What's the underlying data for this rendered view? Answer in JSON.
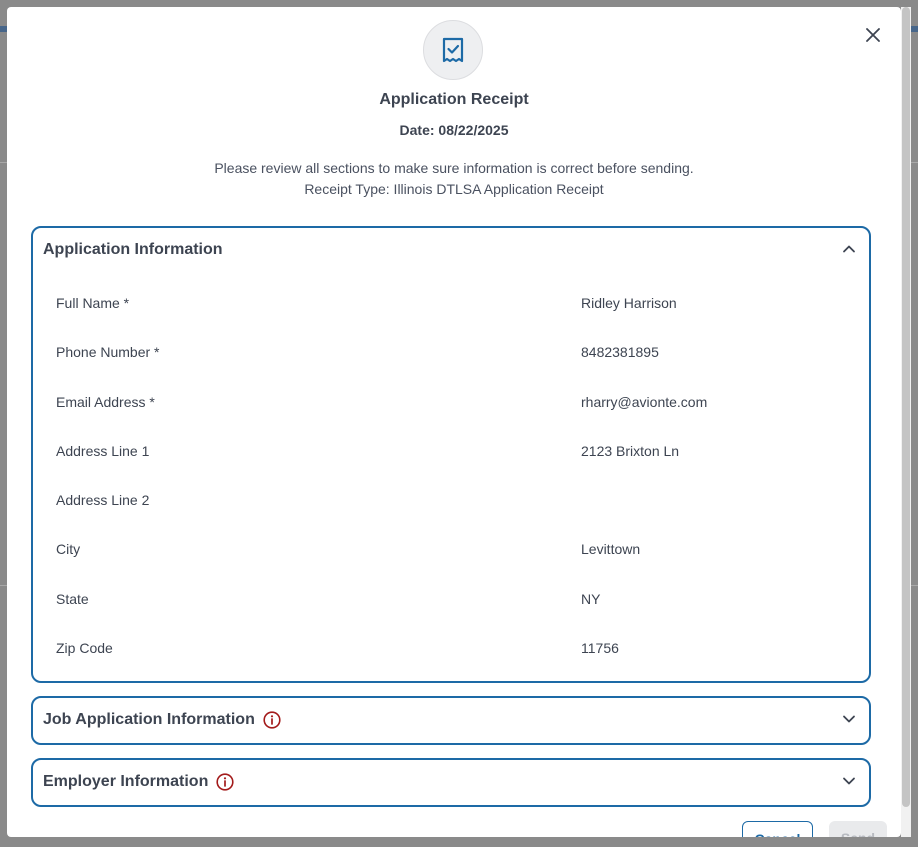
{
  "modal": {
    "title": "Application Receipt",
    "date": "Date: 08/22/2025",
    "description": "Please review all sections to make sure information is correct before sending.",
    "receipt_type": "Receipt Type: Illinois DTLSA Application Receipt",
    "close_icon": "close-icon",
    "header_icon": "receipt-check-icon"
  },
  "sections": {
    "application": {
      "title": "Application Information",
      "expanded": true,
      "fields": [
        {
          "label": "Full Name *",
          "value": "Ridley Harrison"
        },
        {
          "label": "Phone Number *",
          "value": "8482381895"
        },
        {
          "label": "Email Address *",
          "value": "rharry@avionte.com"
        },
        {
          "label": "Address Line 1",
          "value": "2123 Brixton Ln"
        },
        {
          "label": "Address Line 2",
          "value": ""
        },
        {
          "label": "City",
          "value": "Levittown"
        },
        {
          "label": "State",
          "value": "NY"
        },
        {
          "label": "Zip Code",
          "value": "11756"
        }
      ]
    },
    "job": {
      "title": "Job Application Information",
      "expanded": false,
      "warning": true
    },
    "employer": {
      "title": "Employer Information",
      "expanded": false,
      "warning": true
    }
  },
  "footer": {
    "cancel_label": "Cancel",
    "send_label": "Send"
  },
  "colors": {
    "accent": "#1d6aa6",
    "warning": "#a31b1b",
    "text": "#3d4451"
  }
}
